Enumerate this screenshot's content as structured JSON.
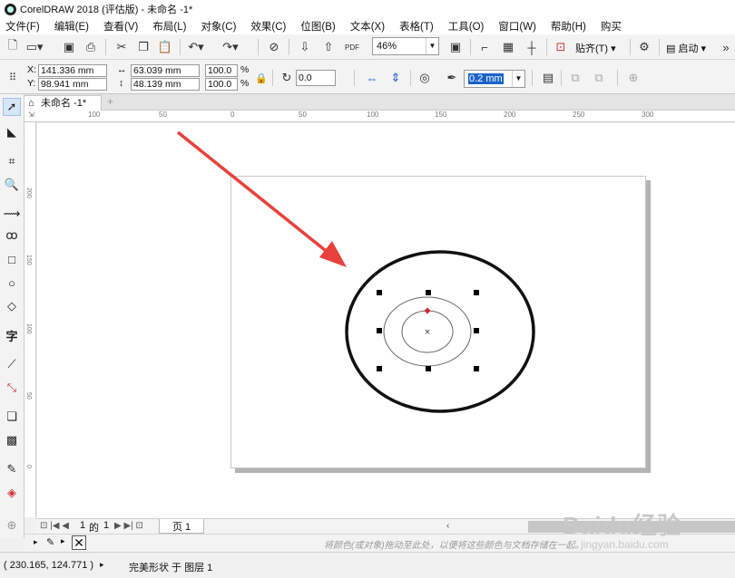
{
  "window": {
    "title": "CorelDRAW 2018 (评估版) - 未命名 -1*"
  },
  "menu": [
    "文件(F)",
    "编辑(E)",
    "查看(V)",
    "布局(L)",
    "对象(C)",
    "效果(C)",
    "位图(B)",
    "文本(X)",
    "表格(T)",
    "工具(O)",
    "窗口(W)",
    "帮助(H)",
    "购买"
  ],
  "toolbar": {
    "zoom": "46%",
    "snap_label": "贴齐(T)",
    "launch_label": "启动"
  },
  "property_bar": {
    "x_label": "X:",
    "x_value": "141.336 mm",
    "y_label": "Y:",
    "y_value": "98.941 mm",
    "width_value": "63.039 mm",
    "height_value": "48.139 mm",
    "scale_x": "100.0",
    "scale_y": "100.0",
    "percent": "%",
    "rotation": "0.0",
    "outline_width": "0.2 mm"
  },
  "doc_tab": {
    "label": "未命名 -1*"
  },
  "rulers": {
    "h_ticks": [
      "100",
      "50",
      "0",
      "50",
      "100",
      "150",
      "200",
      "250",
      "300"
    ],
    "v_ticks": [
      "200",
      "150",
      "100",
      "50",
      "0"
    ]
  },
  "page_nav": {
    "current": "1",
    "of_label": "的",
    "total": "1",
    "page_tab": "页 1"
  },
  "status": {
    "coords": "( 230.165, 124.771 )",
    "object_info": "完美形状 于 图层 1",
    "hint": "将颜色(或对象)拖动至此处，以便将这些颜色与文档存储在一起。"
  },
  "watermark": {
    "text": "Baidu经验",
    "url": "jingyan.baidu.com"
  },
  "colors": {
    "arrow": "#e8413b",
    "node_red": "#d0282d",
    "accent": "#1a63c9"
  }
}
